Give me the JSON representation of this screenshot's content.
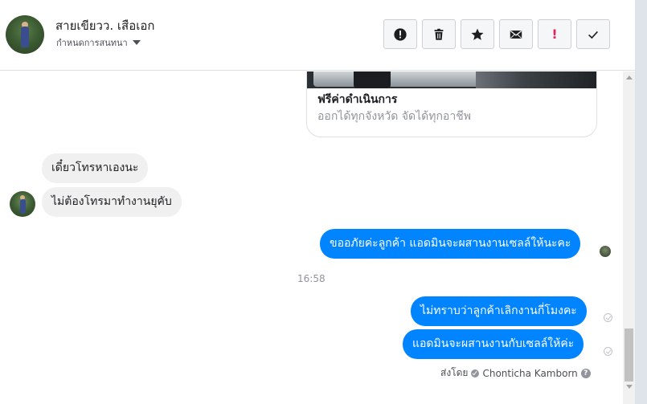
{
  "header": {
    "contact_name": "สายเขียวว. เสือเอก",
    "settings_label": "กำหนดการสนทนา",
    "actions": [
      {
        "name": "report-button",
        "icon": "exclamation-circle-icon"
      },
      {
        "name": "delete-button",
        "icon": "trash-icon"
      },
      {
        "name": "star-button",
        "icon": "star-icon"
      },
      {
        "name": "mark-unread-button",
        "icon": "envelope-icon"
      },
      {
        "name": "mark-important-button",
        "icon": "exclamation-icon"
      },
      {
        "name": "mark-done-button",
        "icon": "checkmark-icon"
      }
    ]
  },
  "link_card": {
    "title": "ฟรีค่าดำเนินการ",
    "subtitle": "ออกได้ทุกจังหวัด จัดได้ทุกอาชีพ"
  },
  "messages": {
    "in_1": "เดี๋ยวโทรหาเองนะ",
    "in_2": "ไม่ต้องโทรมาทำงานยุคับ",
    "out_1": "ขออภัยค่ะลูกค้า แอดมินจะผสานงานเซลล์ให้นะคะ",
    "timestamp": "16:58",
    "out_2": "ไม่ทราบว่าลูกค้าเลิกงานกี่โมงคะ",
    "out_3": "แอดมินจะผสานงานกับเซลล์ให้ค่ะ"
  },
  "sent_by": {
    "prefix": "ส่งโดย",
    "name": "Chonticha Kamborn",
    "help": "?"
  },
  "colors": {
    "outgoing_bubble": "#0084ff",
    "incoming_bubble": "#f1f0f0",
    "important": "#e0245e"
  }
}
